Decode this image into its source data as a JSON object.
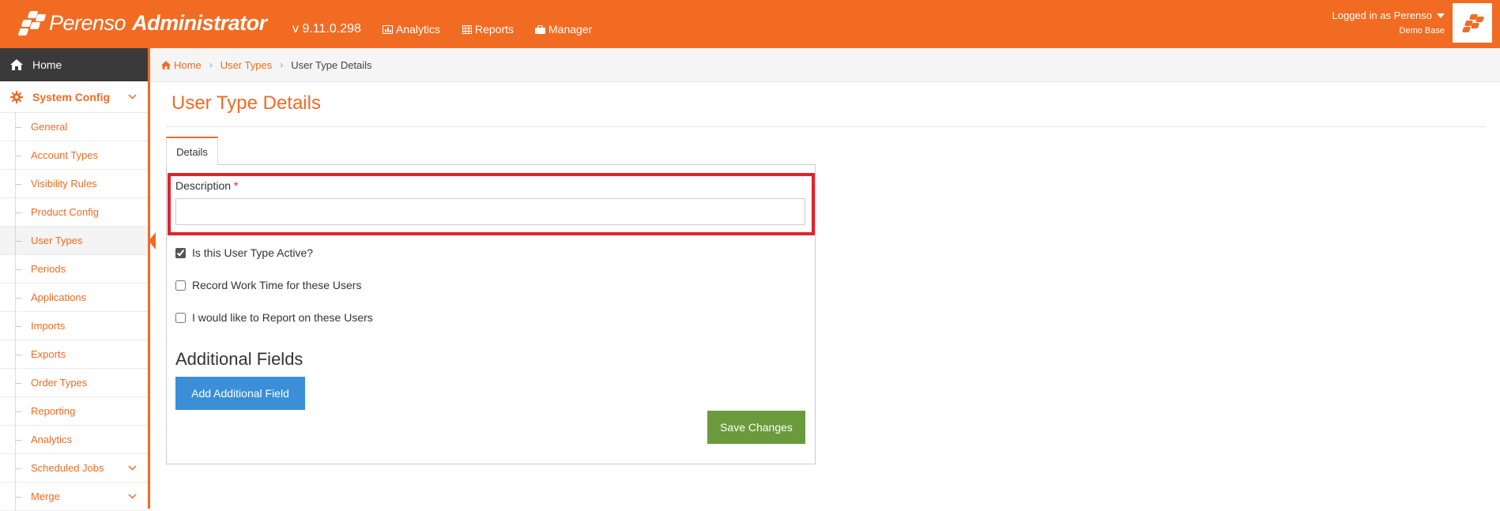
{
  "app": {
    "brand_light": "Perenso",
    "brand_bold": "Administrator",
    "version": "v 9.11.0.298",
    "brand_color": "#f26b22"
  },
  "topnav": {
    "analytics": {
      "label": "Analytics",
      "icon": "chart-icon"
    },
    "reports": {
      "label": "Reports",
      "icon": "table-icon"
    },
    "manager": {
      "label": "Manager",
      "icon": "briefcase-icon"
    }
  },
  "user": {
    "logged_in": "Logged in as Perenso",
    "company": "Demo Base"
  },
  "sidebar": {
    "home": "Home",
    "section": "System Config",
    "items": [
      {
        "label": "General"
      },
      {
        "label": "Account Types"
      },
      {
        "label": "Visibility Rules"
      },
      {
        "label": "Product Config"
      },
      {
        "label": "User Types",
        "active": true
      },
      {
        "label": "Periods"
      },
      {
        "label": "Applications"
      },
      {
        "label": "Imports"
      },
      {
        "label": "Exports"
      },
      {
        "label": "Order Types"
      },
      {
        "label": "Reporting"
      },
      {
        "label": "Analytics"
      },
      {
        "label": "Scheduled Jobs",
        "expandable": true
      },
      {
        "label": "Merge",
        "expandable": true
      }
    ]
  },
  "breadcrumb": {
    "home": "Home",
    "parent": "User Types",
    "current": "User Type Details"
  },
  "page": {
    "title": "User Type Details",
    "tab": "Details"
  },
  "form": {
    "description_label": "Description",
    "required_mark": "*",
    "description_value": "",
    "checkboxes": [
      {
        "label": "Is this User Type Active?",
        "checked": true
      },
      {
        "label": "Record Work Time for these Users",
        "checked": false
      },
      {
        "label": "I would like to Report on these Users",
        "checked": false
      }
    ],
    "additional_heading": "Additional Fields",
    "add_button": "Add Additional Field",
    "save_button": "Save Changes"
  }
}
